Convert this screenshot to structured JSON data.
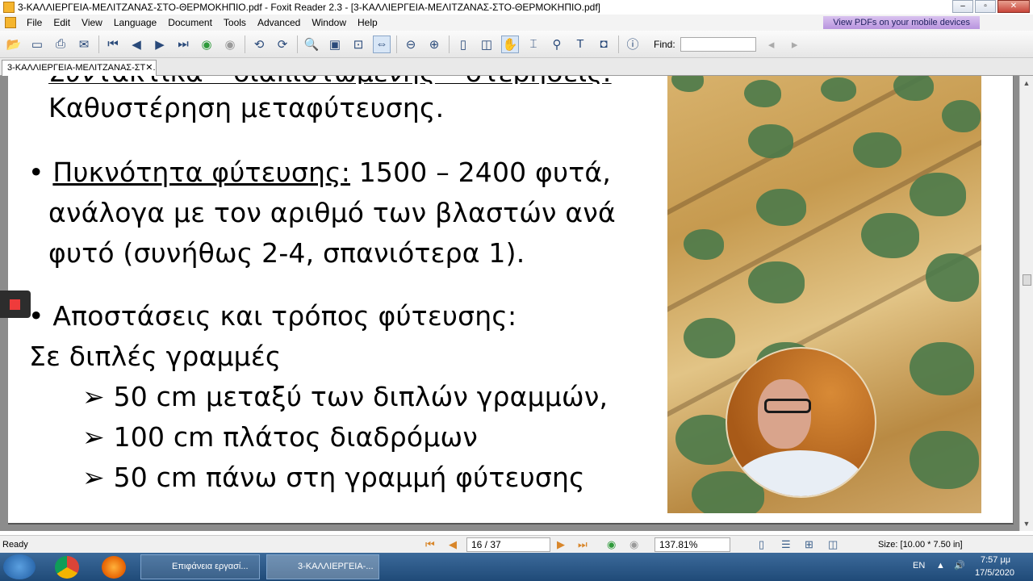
{
  "window": {
    "title": "3-ΚΑΛΛΙΕΡΓΕΙΑ-ΜΕΛΙΤΖΑΝΑΣ-ΣΤΟ-ΘΕΡΜΟΚΗΠΙΟ.pdf - Foxit Reader 2.3 - [3-ΚΑΛΛΙΕΡΓΕΙΑ-ΜΕΛΙΤΖΑΝΑΣ-ΣΤΟ-ΘΕΡΜΟΚΗΠΙΟ.pdf]",
    "minimize": "–",
    "restore": "▫",
    "close": "✕"
  },
  "menu": {
    "items": [
      "File",
      "Edit",
      "View",
      "Language",
      "Document",
      "Tools",
      "Advanced",
      "Window",
      "Help"
    ],
    "promo": "View PDFs on your mobile devices"
  },
  "toolbar": {
    "find_label": "Find:",
    "find_value": ""
  },
  "tab": {
    "label": "3-ΚΑΛΛΙΕΡΓΕΙΑ-ΜΕΛΙΤΖΑΝΑΣ-ΣΤ",
    "close": "✕"
  },
  "slide": {
    "line0_cut": "Συντακτικά – διαπιστωμένης – στερήσεις:",
    "line1": "Καθυστέρηση μεταφύτευσης.",
    "bullet1_label": "Πυκνότητα φύτευσης:",
    "bullet1_rest": " 1500 – 2400 φυτά,",
    "bullet1_line2": "ανάλογα με τον αριθμό των βλαστών ανά",
    "bullet1_line3": "φυτό (συνήθως 2-4, σπανιότερα 1).",
    "bullet2": "Αποστάσεις και τρόπος φύτευσης:",
    "subhead": "Σε διπλές γραμμές",
    "sub1": "50 cm μεταξύ των διπλών γραμμών,",
    "sub2": "100 cm πλάτος διαδρόμων",
    "sub3": "50 cm πάνω στη γραμμή φύτευσης",
    "bullet_glyph": "•",
    "arrow_glyph": "➢"
  },
  "status": {
    "ready": "Ready",
    "page": "16 / 37",
    "zoom": "137.81%",
    "size": "Size: [10.00 * 7.50 in]"
  },
  "taskbar": {
    "desktop_btn": "Επιφάνεια εργασί...",
    "foxit_btn": "3-ΚΑΛΛΙΕΡΓΕΙΑ-...",
    "lang": "EN",
    "time": "7:57 μμ",
    "date": "17/5/2020"
  }
}
